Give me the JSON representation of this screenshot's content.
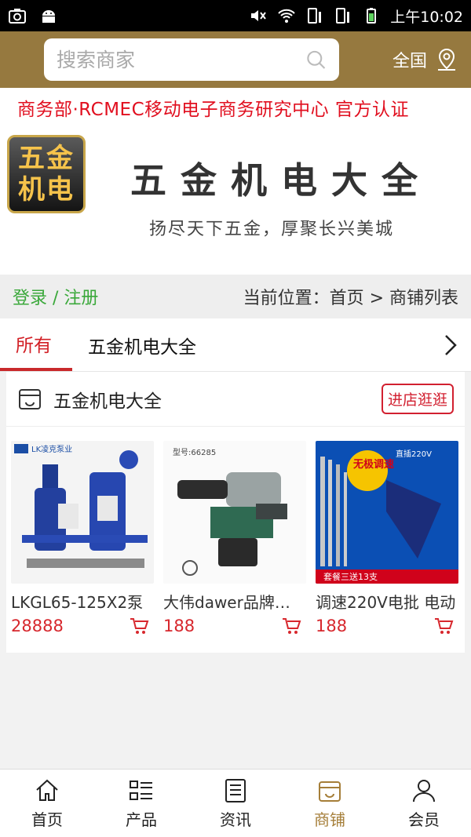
{
  "status": {
    "time": "上午10:02"
  },
  "search": {
    "placeholder": "搜索商家",
    "region": "全国"
  },
  "cert_text": "商务部·RCMEC移动电子商务研究中心 官方认证",
  "brand": {
    "logo_line1": "五金",
    "logo_line2": "机电",
    "title": "五金机电大全",
    "slogan": "扬尽天下五金，厚聚长兴美城"
  },
  "info": {
    "login": "登录 / 注册",
    "breadcrumb": "当前位置：首页 > 商铺列表"
  },
  "tabs": [
    {
      "label": "所有"
    },
    {
      "label": "五金机电大全"
    }
  ],
  "shop": {
    "name": "五金机电大全",
    "enter_label": "进店逛逛",
    "products": [
      {
        "title": "LKGL65-125X2泵",
        "price": "28888",
        "brand_tag": "LK凌克泵业"
      },
      {
        "title": "大伟dawer品牌电锤",
        "price": "188",
        "brand_tag": "型号:66285"
      },
      {
        "title": "调速220V电批 电动",
        "price": "188",
        "badge": "无极调速",
        "tag": "直插220V",
        "footer": "套餐三送13支"
      }
    ]
  },
  "colors": {
    "header_bg": "#96793f",
    "accent_red": "#d7272d",
    "nav_active": "#a57e38",
    "login_green": "#3aa83a"
  },
  "nav": [
    {
      "label": "首页",
      "icon": "home-icon"
    },
    {
      "label": "产品",
      "icon": "list-icon"
    },
    {
      "label": "资讯",
      "icon": "news-icon"
    },
    {
      "label": "商铺",
      "icon": "store-icon",
      "active": true
    },
    {
      "label": "会员",
      "icon": "user-icon"
    }
  ]
}
